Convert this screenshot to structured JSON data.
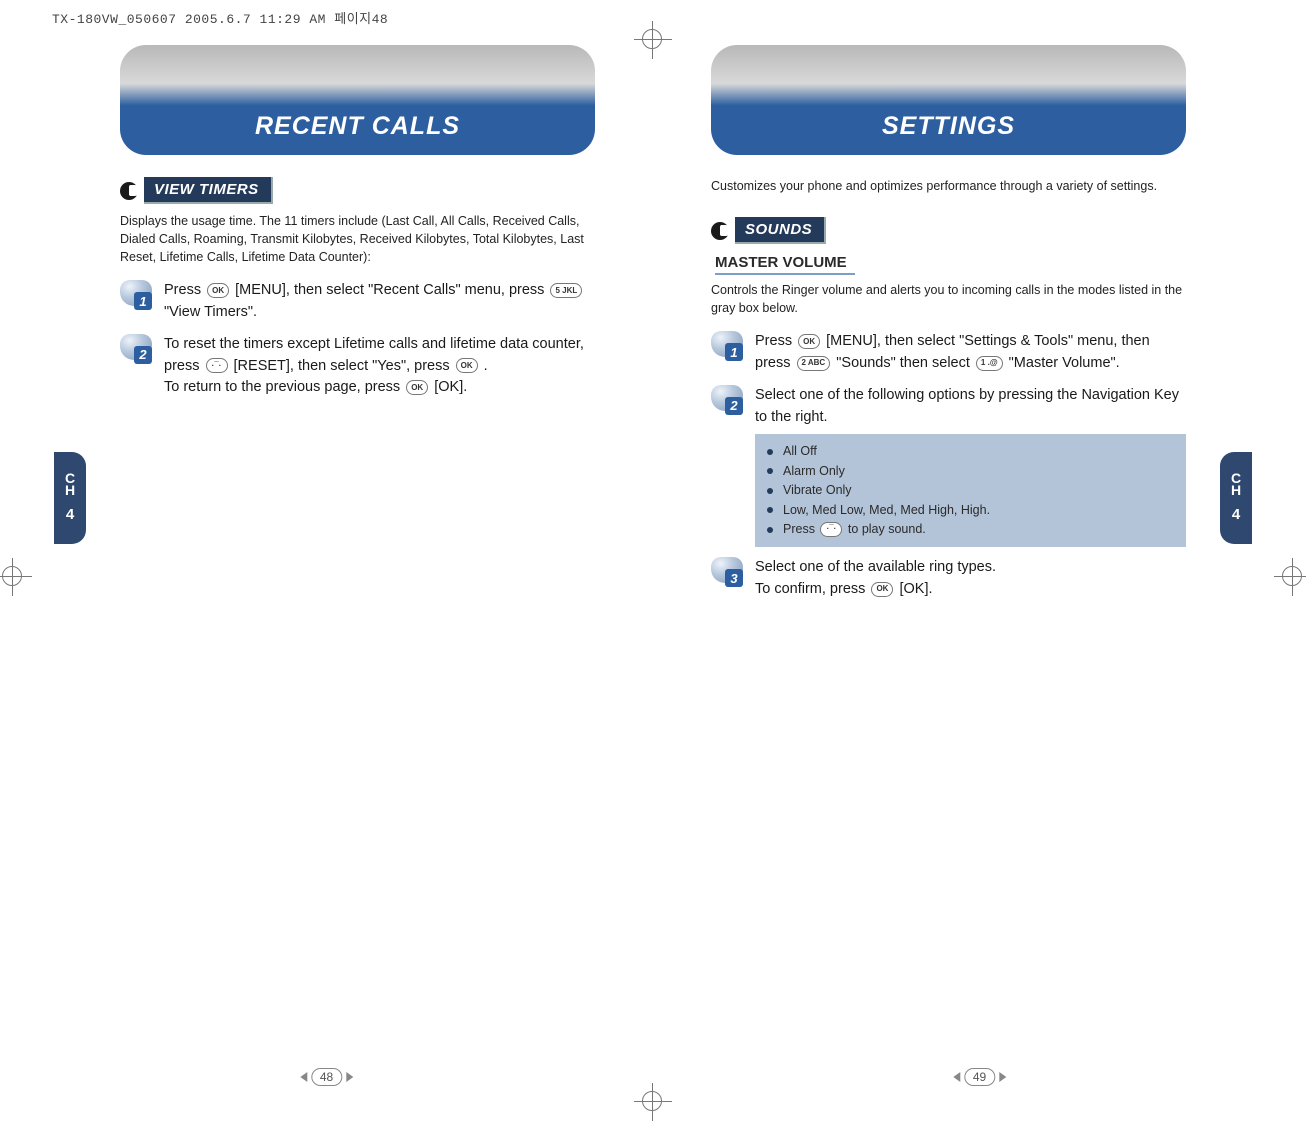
{
  "meta": {
    "header": "TX-180VW_050607  2005.6.7 11:29 AM  페이지48"
  },
  "left": {
    "title": "RECENT CALLS",
    "sidetab": {
      "c": "C",
      "h": "H",
      "n": "4"
    },
    "section": {
      "label": "VIEW TIMERS",
      "desc": "Displays the usage time. The 11 timers include (Last Call, All Calls, Received Calls, Dialed Calls, Roaming, Transmit Kilobytes, Received Kilobytes, Total Kilobytes, Last Reset, Lifetime Calls, Lifetime Data Counter):"
    },
    "steps": {
      "s1": {
        "n": "1",
        "pre": "Press",
        "k1": "OK",
        "mid": "[MENU], then select \"Recent Calls\" menu, press",
        "k2": "5 JKL",
        "post": "\"View Timers\"."
      },
      "s2": {
        "n": "2",
        "l1a": "To reset the timers except Lifetime calls and lifetime data counter, press",
        "k1": "·¯·",
        "l1b": "[RESET], then select \"Yes\", press",
        "k2": "OK",
        "l1c": ".",
        "l2a": "To return to the previous page, press",
        "k3": "OK",
        "l2b": "[OK]."
      }
    },
    "pagenum": "48"
  },
  "right": {
    "title": "SETTINGS",
    "sidetab": {
      "c": "C",
      "h": "H",
      "n": "4"
    },
    "intro": "Customizes your phone and optimizes performance through a variety of settings.",
    "section": {
      "label": "SOUNDS"
    },
    "sub": {
      "heading": "MASTER VOLUME",
      "desc": "Controls the Ringer volume and alerts you to incoming calls in the modes listed in the gray box below."
    },
    "steps": {
      "s1": {
        "n": "1",
        "pre": "Press",
        "k1": "OK",
        "mid1": "[MENU], then select \"Settings & Tools\" menu, then press",
        "k2": "2 ABC",
        "mid2": "\"Sounds\" then select",
        "k3": "1 .@",
        "post": "\"Master Volume\"."
      },
      "s2": {
        "n": "2",
        "text": "Select one of the following options by pressing the Navigation Key to the right."
      },
      "s3": {
        "n": "3",
        "l1": "Select one of the available ring types.",
        "l2a": "To confirm, press",
        "k1": "OK",
        "l2b": "[OK]."
      }
    },
    "options": {
      "o1": "All Off",
      "o2": "Alarm Only",
      "o3": "Vibrate Only",
      "o4": "Low, Med Low, Med, Med High, High.",
      "o5a": "Press",
      "o5k": "·¯·",
      "o5b": "to play sound."
    },
    "pagenum": "49"
  }
}
